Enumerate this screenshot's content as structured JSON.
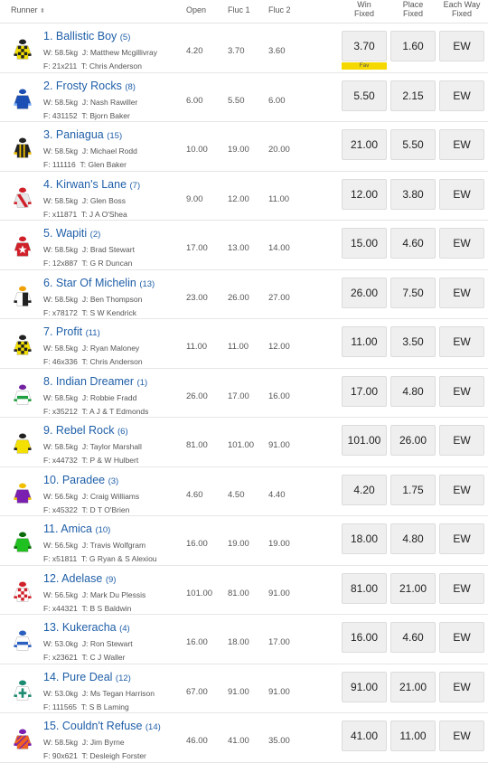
{
  "header": {
    "runner": "Runner",
    "open": "Open",
    "fluc1": "Fluc 1",
    "fluc2": "Fluc 2",
    "win_line1": "Win",
    "win_line2": "Fixed",
    "place_line1": "Place",
    "place_line2": "Fixed",
    "ew_line1": "Each Way",
    "ew_line2": "Fixed",
    "sort_glyph": "⬍"
  },
  "colors": {
    "link": "#1f5fa8",
    "button_bg": "#efefef",
    "fav_bg": "#f5d800"
  },
  "runners": [
    {
      "name": "1. Ballistic Boy",
      "draw": "(5)",
      "weight": "W: 58.5kg",
      "jockey": "J: Matthew Mcgillivray",
      "form": "F: 21x211",
      "trainer": "T: Chris Anderson",
      "open": "4.20",
      "fluc1": "3.70",
      "fluc2": "3.60",
      "win": "3.70",
      "place": "1.60",
      "ew": "EW",
      "fav": "Fav",
      "silk": {
        "body": "#f4e000",
        "alt": "#222",
        "pattern": "check",
        "cap": "#222"
      }
    },
    {
      "name": "2. Frosty Rocks",
      "draw": "(8)",
      "weight": "W: 58.5kg",
      "jockey": "J: Nash Rawiller",
      "form": "F: 431152",
      "trainer": "T: Bjorn Baker",
      "open": "6.00",
      "fluc1": "5.50",
      "fluc2": "6.00",
      "win": "5.50",
      "place": "2.15",
      "ew": "EW",
      "silk": {
        "body": "#1b4fb3",
        "alt": "#7ab0ff",
        "pattern": "plain",
        "cap": "#1b4fb3"
      }
    },
    {
      "name": "3. Paniagua",
      "draw": "(15)",
      "weight": "W: 58.5kg",
      "jockey": "J: Michael Rodd",
      "form": "F: 111116",
      "trainer": "T: Glen Baker",
      "open": "10.00",
      "fluc1": "19.00",
      "fluc2": "20.00",
      "win": "21.00",
      "place": "5.50",
      "ew": "EW",
      "silk": {
        "body": "#222",
        "alt": "#f0c000",
        "pattern": "stripe",
        "cap": "#222"
      }
    },
    {
      "name": "4. Kirwan's Lane",
      "draw": "(7)",
      "weight": "W: 58.5kg",
      "jockey": "J: Glen Boss",
      "form": "F: x11871",
      "trainer": "T: J A O'Shea",
      "open": "9.00",
      "fluc1": "12.00",
      "fluc2": "11.00",
      "win": "12.00",
      "place": "3.80",
      "ew": "EW",
      "silk": {
        "body": "#e8e8e8",
        "alt": "#d0202a",
        "pattern": "sash",
        "cap": "#d0202a"
      }
    },
    {
      "name": "5. Wapiti",
      "draw": "(2)",
      "weight": "W: 58.5kg",
      "jockey": "J: Brad Stewart",
      "form": "F: 12x887",
      "trainer": "T: G R Duncan",
      "open": "17.00",
      "fluc1": "13.00",
      "fluc2": "14.00",
      "win": "15.00",
      "place": "4.60",
      "ew": "EW",
      "silk": {
        "body": "#d0202a",
        "alt": "#ffffff",
        "pattern": "star",
        "cap": "#d0202a"
      }
    },
    {
      "name": "6. Star Of Michelin",
      "draw": "(13)",
      "weight": "W: 58.5kg",
      "jockey": "J: Ben Thompson",
      "form": "F: x78172",
      "trainer": "T: S W Kendrick",
      "open": "23.00",
      "fluc1": "26.00",
      "fluc2": "27.00",
      "win": "26.00",
      "place": "7.50",
      "ew": "EW",
      "silk": {
        "body": "#ffffff",
        "alt": "#222",
        "pattern": "halves",
        "cap": "#f0a000"
      }
    },
    {
      "name": "7. Profit",
      "draw": "(11)",
      "weight": "W: 58.5kg",
      "jockey": "J: Ryan Maloney",
      "form": "F: 46x336",
      "trainer": "T: Chris Anderson",
      "open": "11.00",
      "fluc1": "11.00",
      "fluc2": "12.00",
      "win": "11.00",
      "place": "3.50",
      "ew": "EW",
      "silk": {
        "body": "#f4e000",
        "alt": "#222",
        "pattern": "check",
        "cap": "#222"
      }
    },
    {
      "name": "8. Indian Dreamer",
      "draw": "(1)",
      "weight": "W: 58.5kg",
      "jockey": "J: Robbie Fradd",
      "form": "F: x35212",
      "trainer": "T: A J & T Edmonds",
      "open": "26.00",
      "fluc1": "17.00",
      "fluc2": "16.00",
      "win": "17.00",
      "place": "4.80",
      "ew": "EW",
      "silk": {
        "body": "#ffffff",
        "alt": "#20a040",
        "pattern": "hoop",
        "cap": "#7020a0"
      }
    },
    {
      "name": "9. Rebel Rock",
      "draw": "(6)",
      "weight": "W: 58.5kg",
      "jockey": "J: Taylor Marshall",
      "form": "F: x44732",
      "trainer": "T: P & W Hulbert",
      "open": "81.00",
      "fluc1": "101.00",
      "fluc2": "91.00",
      "win": "101.00",
      "place": "26.00",
      "ew": "EW",
      "silk": {
        "body": "#f4e000",
        "alt": "#222",
        "pattern": "plain",
        "cap": "#222"
      }
    },
    {
      "name": "10. Paradee",
      "draw": "(3)",
      "weight": "W: 56.5kg",
      "jockey": "J: Craig Williams",
      "form": "F: x45322",
      "trainer": "T: D T O'Brien",
      "open": "4.60",
      "fluc1": "4.50",
      "fluc2": "4.40",
      "win": "4.20",
      "place": "1.75",
      "ew": "EW",
      "silk": {
        "body": "#7a1fb0",
        "alt": "#f0c000",
        "pattern": "plain",
        "cap": "#f0c000"
      }
    },
    {
      "name": "11. Amica",
      "draw": "(10)",
      "weight": "W: 56.5kg",
      "jockey": "J: Travis Wolfgram",
      "form": "F: x51811",
      "trainer": "T: G Ryan & S Alexiou",
      "open": "16.00",
      "fluc1": "19.00",
      "fluc2": "19.00",
      "win": "18.00",
      "place": "4.80",
      "ew": "EW",
      "silk": {
        "body": "#20c020",
        "alt": "#0a6a0a",
        "pattern": "plain",
        "cap": "#0a6a0a"
      }
    },
    {
      "name": "12. Adelase",
      "draw": "(9)",
      "weight": "W: 56.5kg",
      "jockey": "J: Mark Du Plessis",
      "form": "F: x44321",
      "trainer": "T: B S Baldwin",
      "open": "101.00",
      "fluc1": "81.00",
      "fluc2": "91.00",
      "win": "81.00",
      "place": "21.00",
      "ew": "EW",
      "silk": {
        "body": "#ffffff",
        "alt": "#d0202a",
        "pattern": "check",
        "cap": "#d0202a"
      }
    },
    {
      "name": "13. Kukeracha",
      "draw": "(4)",
      "weight": "W: 53.0kg",
      "jockey": "J: Ron Stewart",
      "form": "F: x23621",
      "trainer": "T: C J Waller",
      "open": "16.00",
      "fluc1": "18.00",
      "fluc2": "17.00",
      "win": "16.00",
      "place": "4.60",
      "ew": "EW",
      "silk": {
        "body": "#ffffff",
        "alt": "#2a5fc0",
        "pattern": "hoop",
        "cap": "#2a5fc0"
      }
    },
    {
      "name": "14. Pure Deal",
      "draw": "(12)",
      "weight": "W: 53.0kg",
      "jockey": "J: Ms Tegan Harrison",
      "form": "F: 111565",
      "trainer": "T: S B Laming",
      "open": "67.00",
      "fluc1": "91.00",
      "fluc2": "91.00",
      "win": "91.00",
      "place": "21.00",
      "ew": "EW",
      "silk": {
        "body": "#ffffff",
        "alt": "#1a8a70",
        "pattern": "cross",
        "cap": "#1a8a70"
      }
    },
    {
      "name": "15. Couldn't Refuse",
      "draw": "(14)",
      "weight": "W: 58.5kg",
      "jockey": "J: Jim Byrne",
      "form": "F: 90x621",
      "trainer": "T: Desleigh Forster",
      "open": "46.00",
      "fluc1": "41.00",
      "fluc2": "35.00",
      "win": "41.00",
      "place": "11.00",
      "ew": "EW",
      "silk": {
        "body": "#f06020",
        "alt": "#7a1fb0",
        "pattern": "diag",
        "cap": "#7a1fb0"
      }
    }
  ]
}
